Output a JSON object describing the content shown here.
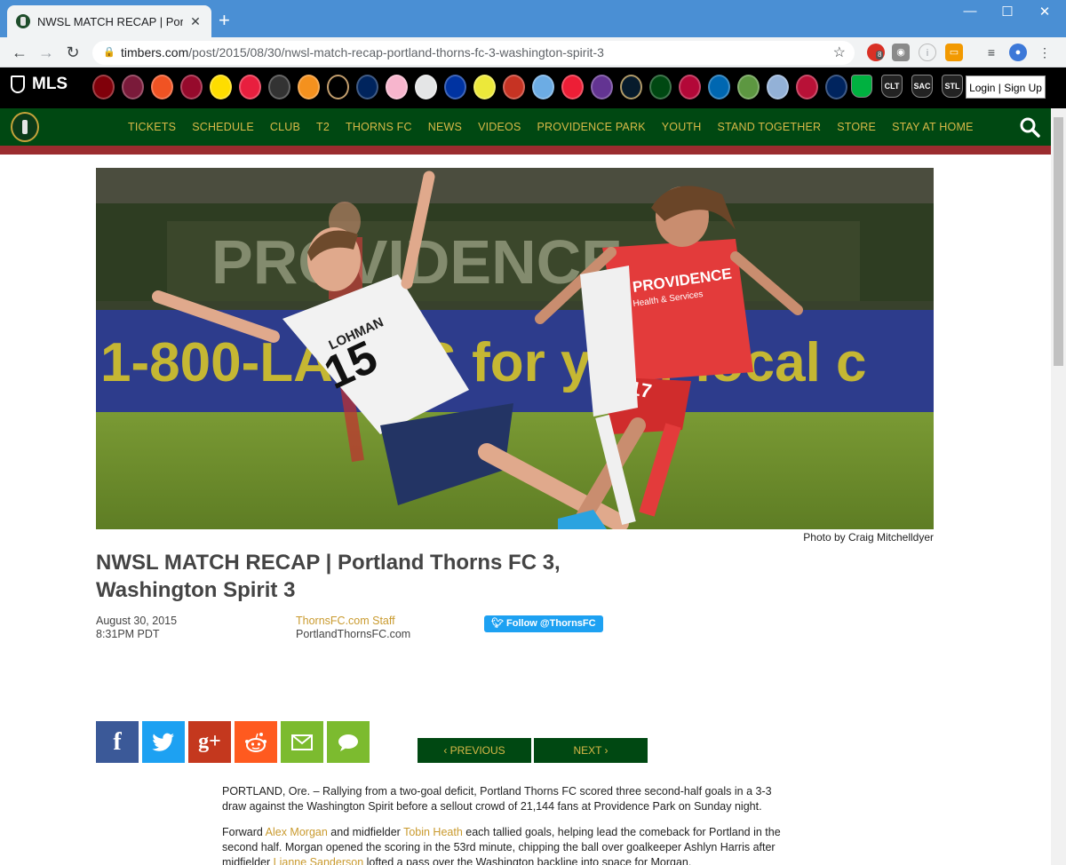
{
  "browser": {
    "tab_title": "NWSL MATCH RECAP | Portland T",
    "url_host": "timbers.com",
    "url_path": "/post/2015/08/30/nwsl-match-recap-portland-thorns-fc-3-washington-spirit-3",
    "extension_badge": "8"
  },
  "mls_bar": {
    "logo_text": "MLS",
    "extra_clubs": [
      "CLT",
      "SAC",
      "STL"
    ],
    "login_label": "Login | Sign Up"
  },
  "nav": {
    "items": [
      "TICKETS",
      "SCHEDULE",
      "CLUB",
      "T2",
      "THORNS FC",
      "NEWS",
      "VIDEOS",
      "PROVIDENCE PARK",
      "YOUTH",
      "STAND TOGETHER",
      "STORE",
      "STAY AT HOME"
    ]
  },
  "article": {
    "photo_credit": "Photo by Craig Mitchelldyer",
    "headline": "NWSL MATCH RECAP | Portland Thorns FC 3, Washington Spirit 3",
    "date": "August 30, 2015",
    "time": "8:31PM PDT",
    "author": "ThornsFC.com Staff",
    "source": "PortlandThornsFC.com",
    "follow_label": "Follow @ThornsFC",
    "hero_text": {
      "player_name": "LOHMAN",
      "player_number": "15",
      "shirt_sponsor": "PROVIDENCE",
      "shirt_sponsor_sub": "Health & Services",
      "red_number": "17",
      "ad_text": "1-800-LA    ESS for your local c"
    },
    "pager": {
      "prev": "‹ PREVIOUS",
      "next": "NEXT ›"
    },
    "p1": "PORTLAND, Ore. – Rallying from a two-goal deficit, Portland Thorns FC scored three second-half goals in a 3-3 draw against the Washington Spirit before a sellout crowd of 21,144 fans at Providence Park on Sunday night.",
    "p2_a": "Forward ",
    "p2_link1": "Alex Morgan",
    "p2_b": " and midfielder ",
    "p2_link2": "Tobin Heath",
    "p2_c": " each tallied goals, helping lead the comeback for Portland in the second half. Morgan opened the scoring in the 53rd minute, chipping the ball over goalkeeper Ashlyn Harris after midfielder ",
    "p2_link3": "Lianne Sanderson",
    "p2_d": " lofted a pass over the Washington backline into space for Morgan."
  },
  "colors": {
    "chrome_blue": "#4a8fd4",
    "nav_green": "#004812",
    "nav_gold": "#d8b948",
    "accent_red": "#9b2c2f",
    "link_gold": "#c99a2e"
  },
  "share_icons": [
    "facebook-icon",
    "twitter-icon",
    "google-plus-icon",
    "reddit-icon",
    "email-icon",
    "comment-icon"
  ]
}
